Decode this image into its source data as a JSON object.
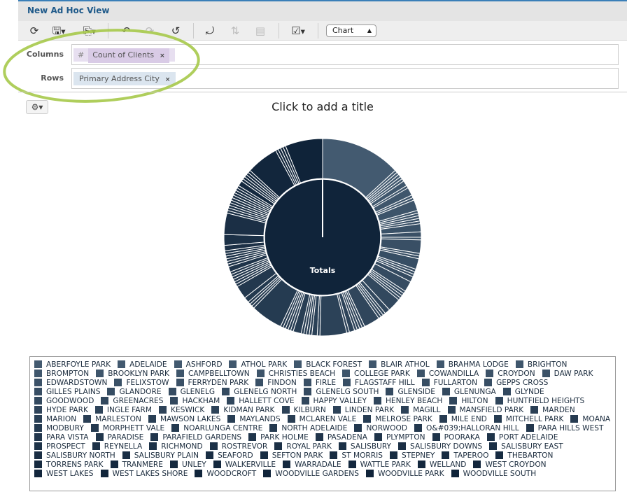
{
  "window": {
    "title": "New Ad Hoc View"
  },
  "toolbar": {
    "icons": [
      "refresh-icon",
      "save-icon",
      "export-icon",
      "undo-icon",
      "redo-icon",
      "undo-all-icon",
      "pivot-icon",
      "sort-icon",
      "page-layout-icon",
      "select-fields-icon"
    ],
    "view_type": "Chart"
  },
  "fields": {
    "columns_label": "Columns",
    "rows_label": "Rows",
    "column_pill": {
      "type_symbol": "#",
      "name": "Count of Clients",
      "remove": "×"
    },
    "row_pill": {
      "name": "Primary Address City",
      "remove": "×"
    }
  },
  "chart_title": "Click to add a title",
  "colors": {
    "light": "#435a70",
    "dark": "#0f2339",
    "center": "#10243a",
    "highlight": "#a6c94a"
  },
  "chart_data": {
    "type": "sunburst",
    "center_label": "Totals",
    "categories": [
      "ABERFOYLE PARK",
      "ADELAIDE",
      "ASHFORD",
      "ATHOL PARK",
      "BLACK FOREST",
      "BLAIR ATHOL",
      "BRAHMA LODGE",
      "BRIGHTON",
      "BROMPTON",
      "BROOKLYN PARK",
      "CAMPBELLTOWN",
      "CHRISTIES BEACH",
      "COLLEGE PARK",
      "COWANDILLA",
      "CROYDON",
      "DAW PARK",
      "EDWARDSTOWN",
      "FELIXSTOW",
      "FERRYDEN PARK",
      "FINDON",
      "FIRLE",
      "FLAGSTAFF HILL",
      "FULLARTON",
      "GEPPS CROSS",
      "GILLES PLAINS",
      "GLANDORE",
      "GLENELG",
      "GLENELG NORTH",
      "GLENELG SOUTH",
      "GLENSIDE",
      "GLENUNGA",
      "GLYNDE",
      "GOODWOOD",
      "GREENACRES",
      "HACKHAM",
      "HALLETT COVE",
      "HAPPY VALLEY",
      "HENLEY BEACH",
      "HILTON",
      "HUNTFIELD HEIGHTS",
      "HYDE PARK",
      "INGLE FARM",
      "KESWICK",
      "KIDMAN PARK",
      "KILBURN",
      "LINDEN PARK",
      "MAGILL",
      "MANSFIELD PARK",
      "MARDEN",
      "MARION",
      "MARLESTON",
      "MAWSON LAKES",
      "MAYLANDS",
      "MCLAREN VALE",
      "MELROSE PARK",
      "MILE END",
      "MITCHELL PARK",
      "MOANA",
      "MODBURY",
      "MORPHETT VALE",
      "NOARLUNGA CENTRE",
      "NORTH ADELAIDE",
      "NORWOOD",
      "O&#039;HALLORAN HILL",
      "PARA HILLS WEST",
      "PARA VISTA",
      "PARADISE",
      "PARAFIELD GARDENS",
      "PARK HOLME",
      "PASADENA",
      "PLYMPTON",
      "POORAKA",
      "PORT ADELAIDE",
      "PROSPECT",
      "REYNELLA",
      "RICHMOND",
      "ROSTREVOR",
      "ROYAL PARK",
      "SALISBURY",
      "SALISBURY DOWNS",
      "SALISBURY EAST",
      "SALISBURY NORTH",
      "SALISBURY PLAIN",
      "SEAFORD",
      "SEFTON PARK",
      "ST MORRIS",
      "STEPNEY",
      "TAPEROO",
      "THEBARTON",
      "TORRENS PARK",
      "TRANMERE",
      "UNLEY",
      "WALKERVILLE",
      "WARRADALE",
      "WATTLE PARK",
      "WELLAND",
      "WEST CROYDON",
      "WEST LAKES",
      "WEST LAKES SHORE",
      "WOODCROFT",
      "WOODVILLE GARDENS",
      "WOODVILLE PARK",
      "WOODVILLE SOUTH"
    ],
    "values": [
      30,
      1,
      1,
      1,
      1,
      1,
      2,
      1,
      3,
      1,
      1,
      4,
      1,
      1,
      1,
      1,
      1,
      3,
      2,
      1,
      5,
      1,
      1,
      4,
      1,
      1,
      1,
      2,
      4,
      1,
      1,
      1,
      1,
      5,
      2,
      1,
      1,
      1,
      6,
      1,
      1,
      1,
      1,
      2,
      1,
      10,
      1,
      2,
      1,
      1,
      1,
      1,
      3,
      1,
      1,
      1,
      1,
      1,
      12,
      1,
      1,
      1,
      2,
      5,
      1,
      1,
      1,
      1,
      1,
      1,
      2,
      1,
      1,
      1,
      1,
      1,
      1,
      2,
      4,
      8,
      1,
      1,
      1,
      1,
      1,
      1,
      1,
      1,
      1,
      1,
      1,
      2,
      1,
      1,
      1,
      1,
      1,
      12,
      1,
      1,
      1,
      1,
      14
    ],
    "legend": "bottom"
  }
}
